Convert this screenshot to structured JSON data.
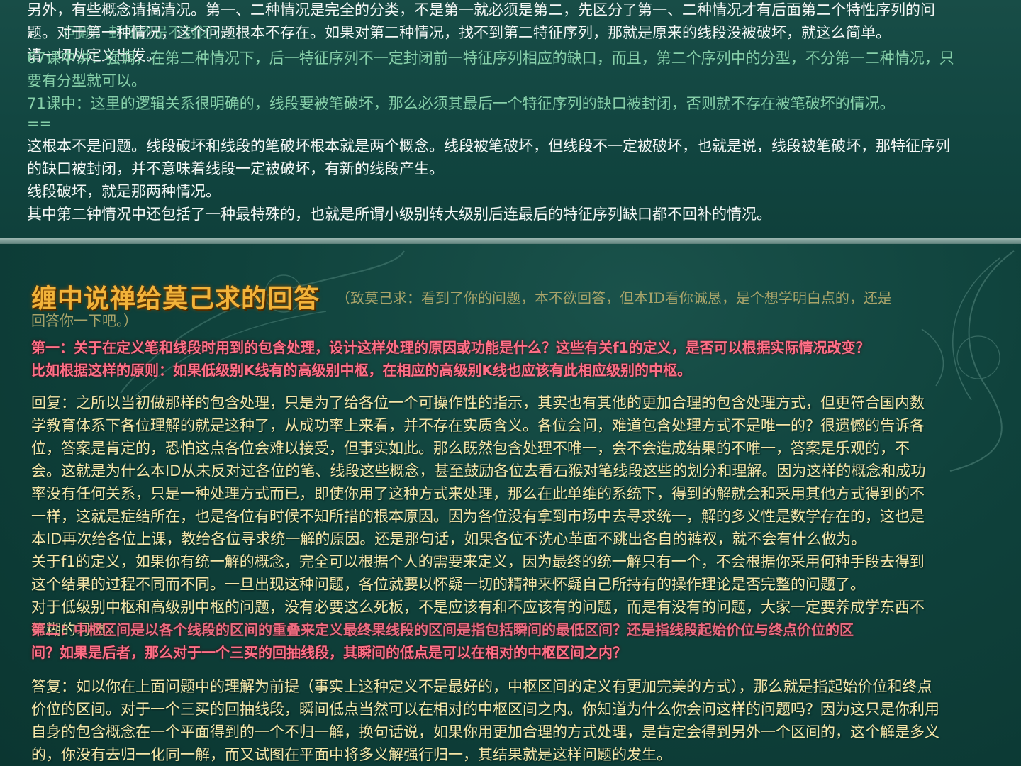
{
  "top": {
    "lines": [
      "另外，有些概念请搞清况。第一、二种情况是完全的分类，不是第一就必须是第二，先区分了第一、二种情况才有后面第二个特性序列的问",
      "题。对于第一种情况，这个问题根本不存在。如果对第二种情况，找不到第二特征序列，那就是原来的线段没被破坏，就这么简单。",
      "请一切从定义出发。"
    ],
    "ghost_line": "问题：封闭还是不封闭？",
    "green_lines": [
      "67课中讲：强调，在第二种情况下，后一特征序列不一定封闭前一特征序列相应的缺口，而且，第二个序列中的分型，不分第一二种情况，只",
      "要有分型就可以。",
      "71课中：这里的逻辑关系很明确的，线段要被笔破坏，那么必须其最后一个特征序列的缺口被封闭，否则就不存在被笔破坏的情况。",
      "=="
    ],
    "reply_lines": [
      "这根本不是问题。线段破坏和线段的笔破坏根本就是两个概念。线段被笔破坏，但线段不一定被破坏，也就是说，线段被笔破坏，那特征序列",
      "的缺口被封闭，并不意味着线段一定被破坏，有新的线段产生。",
      "线段破坏，就是那两种情况。",
      "其中第二钟情况中还包括了一种最特殊的，也就是所谓小级别转大级别后连最后的特征序列缺口都不回补的情况。"
    ]
  },
  "bottom": {
    "title": "缠中说禅给莫己求的回答",
    "subtitle_1": "（致莫己求：看到了你的问题，本不欲回答，但本ID看你诚恳，是个想学明白点的，还是",
    "subtitle_2": "回答你一下吧。）",
    "q1": [
      "第一：关于在定义笔和线段时用到的包含处理，设计这样处理的原因或功能是什么？这些有关f1的定义，是否可以根据实际情况改变？",
      "比如根据这样的原则：如果低级别K线有的高级别中枢，在相应的高级别K线也应该有此相应级别的中枢。"
    ],
    "a1": [
      "回复：之所以当初做那样的包含处理，只是为了给各位一个可操作性的指示，其实也有其他的更加合理的包含处理方式，但更符合国内数",
      "学教育体系下各位理解的就是这种了，从成功率上来看，并不存在实质含义。各位会问，难道包含处理方式不是唯一的？很遗憾的告诉各",
      "位，答案是肯定的，恐怕这点各位会难以接受，但事实如此。那么既然包含处理不唯一，会不会造成结果的不唯一，答案是乐观的，不",
      "会。这就是为什么本ID从未反对过各位的笔、线段这些概念，甚至鼓励各位去看石猴对笔线段这些的划分和理解。因为这样的概念和成功",
      "率没有任何关系，只是一种处理方式而已，即使你用了这种方式来处理，那么在此单维的系统下，得到的解就会和采用其他方式得到的不",
      "一样，这就是症结所在，也是各位有时候不知所措的根本原因。因为各位没有拿到市场中去寻求统一，解的多义性是数学存在的，这也是",
      "本ID再次给各位上课，教给各位寻求统一解的原因。还是那句话，如果各位不洗心革面不跳出各自的裤衩，就不会有什么做为。",
      "关于f1的定义，如果你有统一解的概念，完全可以根据个人的需要来定义，因为最终的统一解只有一个，不会根据你采用何种手段去得到",
      "这个结果的过程不同而不同。一旦出现这种问题，各位就要以怀疑一切的精神来怀疑自己所持有的操作理论是否完整的问题了。",
      "对于低级别中枢和高级别中枢的问题，没有必要这么死板，不是应该有和不应该有的问题，而是有没有的问题，大家一定要养成学东西不"
    ],
    "q2_overlap": "第二：中枢区间是以各个线段的区间的重叠来定义最终果线段的区间是指包括瞬间的最低区间？还是指线段起始价位与终点价位的区",
    "a1_overlap": "死糊的习惯。",
    "q2_line2": "间？如果是后者，那么对于一个三买的回抽线段，其瞬间的低点是可以在相对的中枢区间之内？",
    "a2": [
      "答复：如以你在上面问题中的理解为前提（事实上这种定义不是最好的，中枢区间的定义有更加完美的方式），那么就是指起始价位和终点",
      "价位的区间。对于一个三买的回抽线段，瞬间低点当然可以在相对的中枢区间之内。你知道为什么你会问这样的问题吗？因为这只是你利用",
      "自身的包含概念在一个平面得到的一个不归一解，换句话说，如果你用更加合理的方式处理，是肯定会得到另外一个区间的，这个解是多义",
      "的，你没有去归一化同一解，而又试图在平面中将多义解强行归一，其结果就是这样问题的发生。"
    ]
  }
}
